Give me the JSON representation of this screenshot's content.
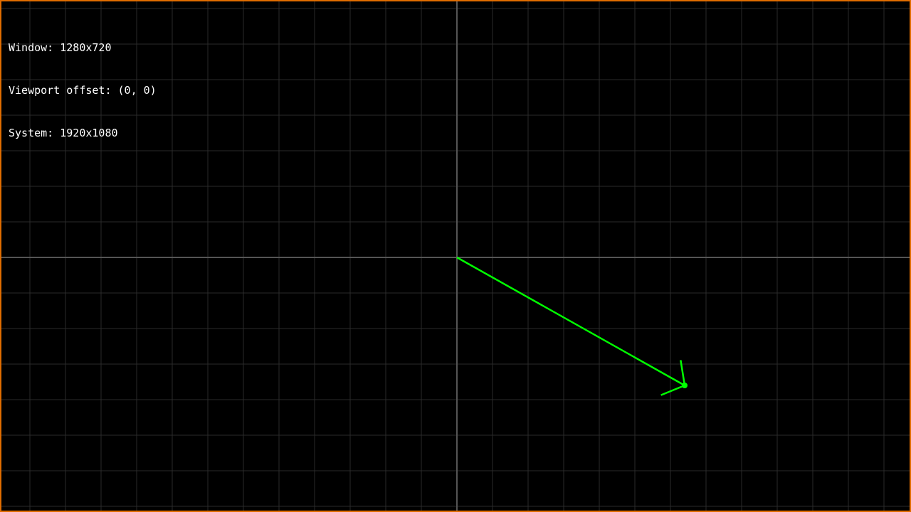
{
  "window": {
    "border_color": "#e06c00",
    "background": "#000000"
  },
  "info": {
    "window_line": "Window: 1280x720",
    "viewport_line": "Viewport offset: (0, 0)",
    "system_line": "System: 1920x1080"
  },
  "scene": {
    "grid_color": "#2a2a2a",
    "axis_color": "#555555",
    "vector": {
      "color": "#00ff00",
      "start": [
        0,
        0
      ],
      "end": [
        320,
        -180
      ]
    }
  }
}
